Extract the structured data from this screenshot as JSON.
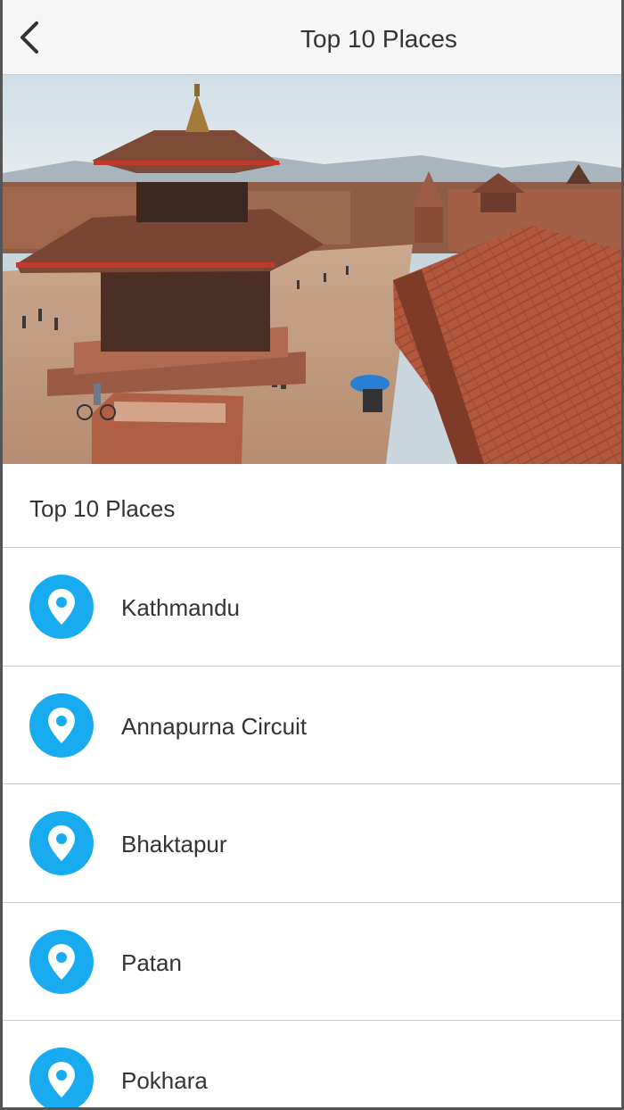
{
  "navbar": {
    "back_icon": "chevron-left-icon",
    "title": "Top 10 Places"
  },
  "hero": {
    "description_icon": "photo"
  },
  "list": {
    "header": "Top 10 Places",
    "item_icon": "map-pin-icon",
    "accent_color": "#18abf0",
    "items": [
      {
        "label": "Kathmandu"
      },
      {
        "label": "Annapurna Circuit"
      },
      {
        "label": "Bhaktapur"
      },
      {
        "label": "Patan"
      },
      {
        "label": "Pokhara"
      }
    ]
  }
}
